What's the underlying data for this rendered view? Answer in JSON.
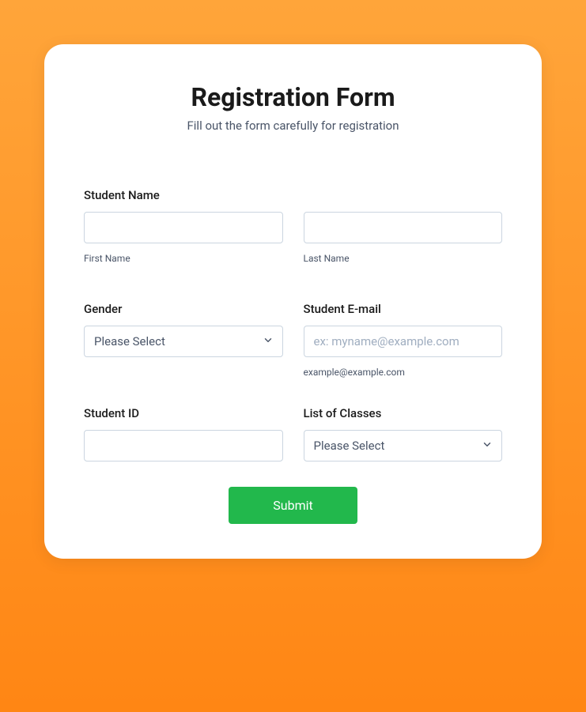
{
  "header": {
    "title": "Registration Form",
    "subtitle": "Fill out the form carefully for registration"
  },
  "fields": {
    "studentName": {
      "label": "Student Name",
      "first": {
        "value": "",
        "sublabel": "First Name"
      },
      "last": {
        "value": "",
        "sublabel": "Last Name"
      }
    },
    "gender": {
      "label": "Gender",
      "selected": "Please Select"
    },
    "email": {
      "label": "Student E-mail",
      "value": "",
      "placeholder": "ex: myname@example.com",
      "sublabel": "example@example.com"
    },
    "studentId": {
      "label": "Student ID",
      "value": ""
    },
    "classes": {
      "label": "List of Classes",
      "selected": "Please Select"
    }
  },
  "submit": {
    "label": "Submit"
  }
}
